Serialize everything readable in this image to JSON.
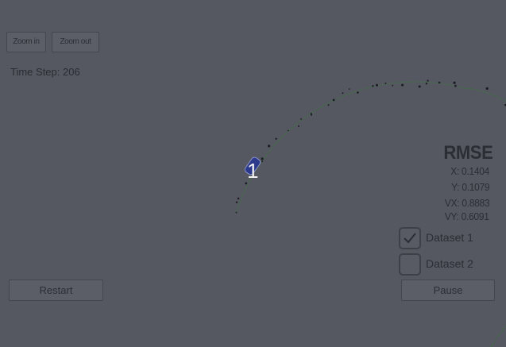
{
  "controls": {
    "zoom_in": "Zoom in",
    "zoom_out": "Zoom out",
    "restart": "Restart",
    "pause": "Pause"
  },
  "status": {
    "time_step": "Time Step: 206"
  },
  "vehicle": {
    "label": "1"
  },
  "rmse": {
    "title": "RMSE",
    "x": "X: 0.1404",
    "y": "Y: 0.1079",
    "vx": "VX: 0.8883",
    "vy": "VY: 0.6091"
  },
  "datasets": [
    {
      "label": "Dataset 1",
      "checked": true
    },
    {
      "label": "Dataset 2",
      "checked": false
    }
  ],
  "colors": {
    "background": "#555761",
    "vehicle": "#2d3a8c",
    "trajectory": "#3a7a3a",
    "measurements": "#1c1d22"
  }
}
